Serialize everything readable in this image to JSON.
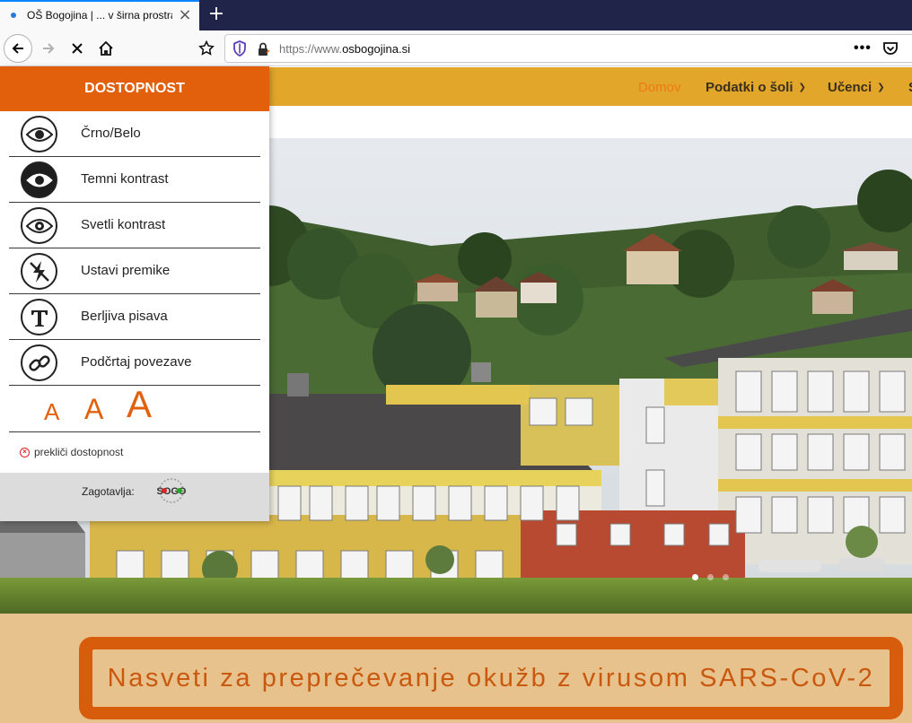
{
  "browser": {
    "tab_title": "OŠ Bogojina | ... v širna prostranstva",
    "tab_close": "×",
    "new_tab": "+",
    "url_prefix": "https://www.",
    "url_host": "osbogojina.si",
    "url_suffix": "",
    "page_actions": "•••"
  },
  "site_menu": {
    "items": [
      {
        "label": "Domov",
        "active": true,
        "dropdown": false
      },
      {
        "label": "Podatki o šoli",
        "active": false,
        "dropdown": true
      },
      {
        "label": "Učenci",
        "active": false,
        "dropdown": true
      },
      {
        "label": "S",
        "active": false,
        "dropdown": false
      }
    ]
  },
  "accessibility": {
    "title": "DOSTOPNOST",
    "options": [
      {
        "label": "Črno/Belo",
        "icon": "eye-icon"
      },
      {
        "label": "Temni kontrast",
        "icon": "eye-dark-icon"
      },
      {
        "label": "Svetli kontrast",
        "icon": "eye-icon"
      },
      {
        "label": "Ustavi premike",
        "icon": "no-motion-icon"
      },
      {
        "label": "Berljiva pisava",
        "icon": "font-t-icon"
      },
      {
        "label": "Podčrtaj povezave",
        "icon": "link-icon"
      }
    ],
    "font_sizes": [
      "A",
      "A",
      "A"
    ],
    "cancel_label": "prekliči dostopnost",
    "footer_label": "Zagotavlja:",
    "provider_logo_text": "SOGO"
  },
  "slider": {
    "dots": 3,
    "active_dot": 1
  },
  "notice": {
    "text": "Nasveti za preprečevanje okužb z virusom SARS-CoV-2"
  },
  "colors": {
    "header_orange": "#e2600c",
    "menu_gold": "#e2a62b",
    "notice_tan": "#e8c28c",
    "notice_border": "#d75d0d",
    "active_menu": "#ee7a16"
  }
}
